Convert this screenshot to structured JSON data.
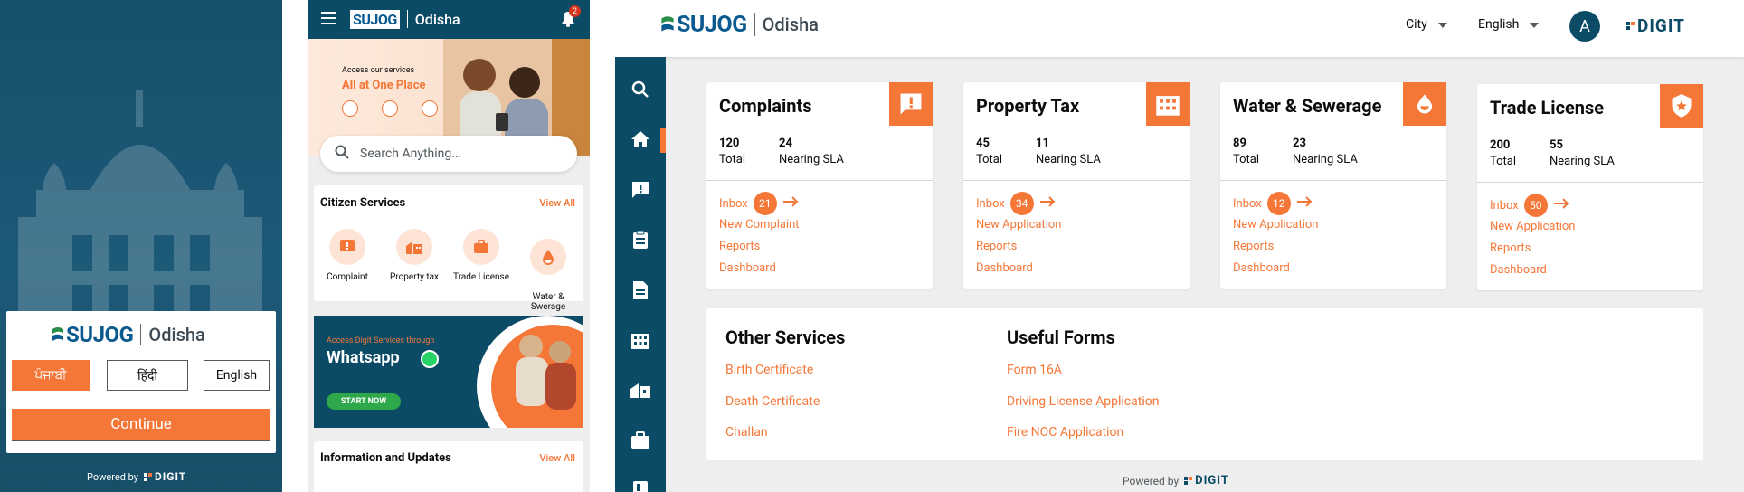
{
  "brand": {
    "logo": "SUJOG",
    "city": "Odisha",
    "powered_by": "Powered by",
    "digit": "DIGIT"
  },
  "language_select": {
    "languages": [
      "ਪੰਜਾਬੀ",
      "हिंदी",
      "English"
    ],
    "selected": "ਪੰਜਾਬੀ",
    "continue_label": "Continue"
  },
  "mobile": {
    "notification_count": "2",
    "banner": {
      "line1": "Access our services",
      "line2": "All at One Place"
    },
    "search_placeholder": "Search Anything...",
    "citizen_services": {
      "title": "Citizen Services",
      "view_all": "View All",
      "items": [
        {
          "label": "Complaint",
          "icon": "complaint-icon"
        },
        {
          "label": "Property tax",
          "icon": "property-tax-icon"
        },
        {
          "label": "Trade License",
          "icon": "trade-license-icon"
        },
        {
          "label": "Water &\nSwerage",
          "icon": "water-drop-icon"
        }
      ]
    },
    "whatsapp_banner": {
      "line1": "Access Digit Services through",
      "line2": "Whatsapp",
      "cta": "START NOW"
    },
    "info_updates": {
      "title": "Information and Updates",
      "view_all": "View All"
    }
  },
  "desktop": {
    "header": {
      "city_dropdown": "City",
      "language_dropdown": "English",
      "avatar_initial": "A"
    },
    "sidebar_icons": [
      "search-icon",
      "home-icon",
      "complaint-icon",
      "clipboard-icon",
      "document-icon",
      "building-icon",
      "property-icon",
      "briefcase-icon",
      "book-icon"
    ],
    "modules": [
      {
        "title": "Complaints",
        "icon": "complaint-icon",
        "total": "120",
        "total_label": "Total",
        "sla": "24",
        "sla_label": "Nearing SLA",
        "inbox_label": "Inbox",
        "inbox_count": "21",
        "links": [
          "New Complaint",
          "Reports",
          "Dashboard"
        ]
      },
      {
        "title": "Property Tax",
        "icon": "building-icon",
        "total": "45",
        "total_label": "Total",
        "sla": "11",
        "sla_label": "Nearing SLA",
        "inbox_label": "Inbox",
        "inbox_count": "34",
        "links": [
          "New Application",
          "Reports",
          "Dashboard"
        ]
      },
      {
        "title": "Water & Sewerage",
        "icon": "water-drop-icon",
        "total": "89",
        "total_label": "Total",
        "sla": "23",
        "sla_label": "Nearing SLA",
        "inbox_label": "Inbox",
        "inbox_count": "12",
        "links": [
          "New Application",
          "Reports",
          "Dashboard"
        ]
      },
      {
        "title": "Trade License",
        "icon": "shield-icon",
        "total": "200",
        "total_label": "Total",
        "sla": "55",
        "sla_label": "Nearing SLA",
        "inbox_label": "Inbox",
        "inbox_count": "50",
        "links": [
          "New Application",
          "Reports",
          "Dashboard"
        ]
      }
    ],
    "other_services": {
      "title": "Other Services",
      "links": [
        "Birth Certificate",
        "Death Certificate",
        "Challan"
      ]
    },
    "useful_forms": {
      "title": "Useful Forms",
      "links": [
        "Form 16A",
        "Driving License Application",
        "Fire NOC Application"
      ]
    }
  },
  "colors": {
    "accent": "#f47738",
    "primary": "#0b4b66",
    "background": "#eeeeee"
  }
}
